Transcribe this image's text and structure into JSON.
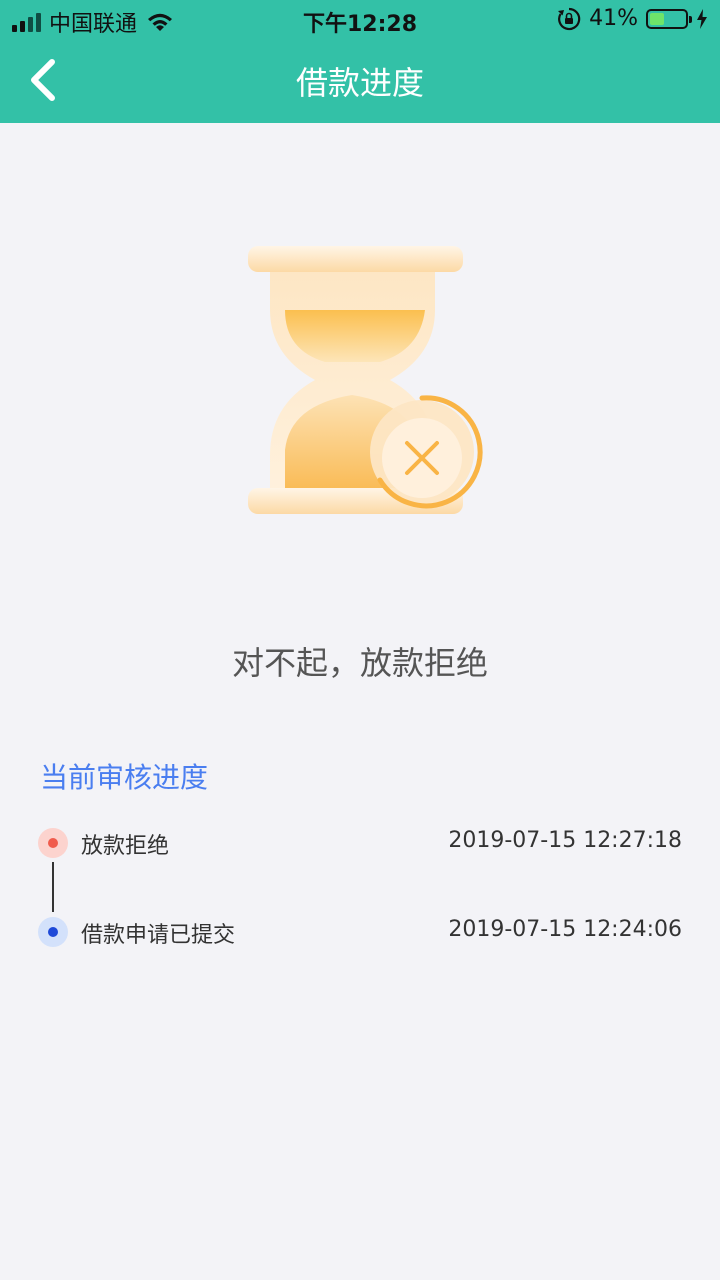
{
  "status_bar": {
    "carrier": "中国联通",
    "time": "下午12:28",
    "battery_percent": "41%",
    "battery_level": 0.41,
    "icons": [
      "signal-icon",
      "wifi-icon",
      "rotation-lock-icon",
      "battery-icon",
      "charging-icon"
    ]
  },
  "nav": {
    "title": "借款进度",
    "back_icon": "chevron-left-icon"
  },
  "result": {
    "icon": "hourglass-rejected-icon",
    "message": "对不起，放款拒绝"
  },
  "progress": {
    "title": "当前审核进度",
    "items": [
      {
        "label": "放款拒绝",
        "time": "2019-07-15 12:27:18",
        "status": "rejected",
        "color": "#f05b4c"
      },
      {
        "label": "借款申请已提交",
        "time": "2019-07-15 12:24:06",
        "status": "submitted",
        "color": "#1e49d8"
      }
    ]
  },
  "colors": {
    "header": "#33c1a7",
    "background": "#f3f3f7",
    "accent_blue": "#4a7ef0",
    "hourglass_orange": "#f9b445"
  }
}
